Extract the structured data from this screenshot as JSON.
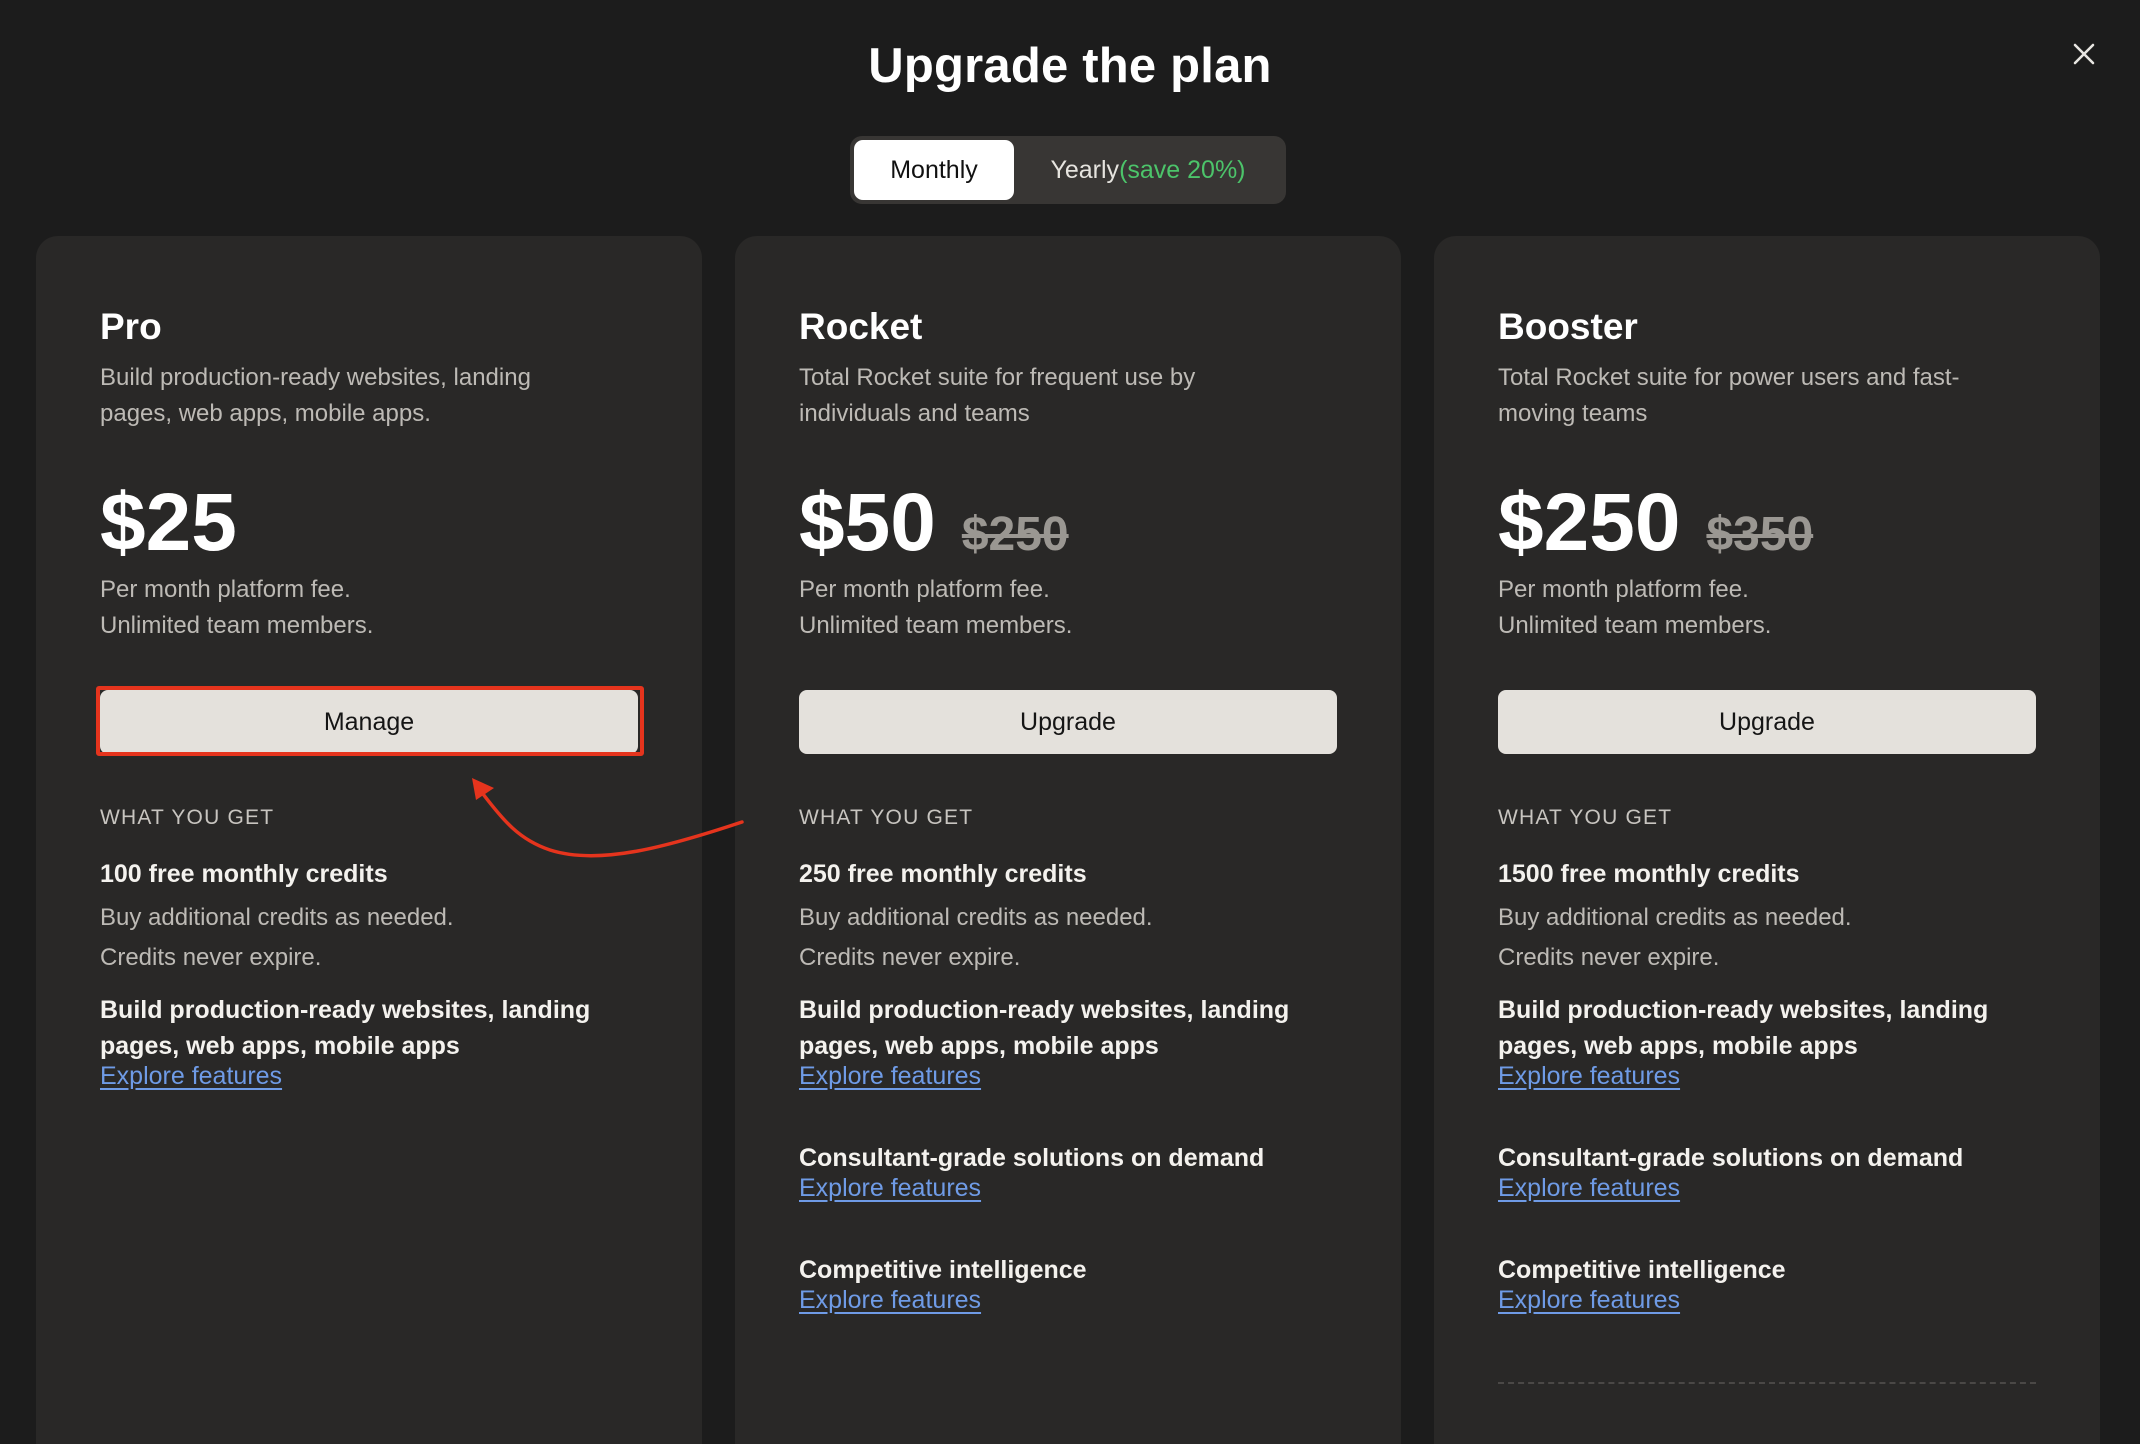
{
  "header": {
    "title": "Upgrade the plan",
    "close_icon": "close-icon"
  },
  "billing_toggle": {
    "monthly_label": "Monthly",
    "yearly_label": "Yearly",
    "yearly_savings": "(save 20%)",
    "selected": "Monthly"
  },
  "plans": [
    {
      "name": "Pro",
      "description": "Build production-ready websites, landing pages, web apps, mobile apps.",
      "price": "$25",
      "old_price": "",
      "fee_line1": "Per month platform fee.",
      "fee_line2": "Unlimited team members.",
      "button_label": "Manage",
      "section_label": "WHAT YOU GET",
      "credits_title": "100 free monthly credits",
      "credits_line1": "Buy additional credits as needed.",
      "credits_line2": "Credits never expire.",
      "features": [
        {
          "title": "Build production-ready websites, landing pages, web apps, mobile apps",
          "link": "Explore features"
        }
      ]
    },
    {
      "name": "Rocket",
      "description": "Total Rocket suite for frequent use by individuals and teams",
      "price": "$50",
      "old_price": "$250",
      "fee_line1": "Per month platform fee.",
      "fee_line2": "Unlimited team members.",
      "button_label": "Upgrade",
      "section_label": "WHAT YOU GET",
      "credits_title": "250 free monthly credits",
      "credits_line1": "Buy additional credits as needed.",
      "credits_line2": "Credits never expire.",
      "features": [
        {
          "title": "Build production-ready websites, landing pages, web apps, mobile apps",
          "link": "Explore features"
        },
        {
          "title": "Consultant-grade solutions on demand",
          "link": "Explore features"
        },
        {
          "title": "Competitive intelligence",
          "link": "Explore features"
        }
      ]
    },
    {
      "name": "Booster",
      "description": "Total Rocket suite for power users and fast-moving teams",
      "price": "$250",
      "old_price": "$350",
      "fee_line1": "Per month platform fee.",
      "fee_line2": "Unlimited team members.",
      "button_label": "Upgrade",
      "section_label": "WHAT YOU GET",
      "credits_title": "1500 free monthly credits",
      "credits_line1": "Buy additional credits as needed.",
      "credits_line2": "Credits never expire.",
      "features": [
        {
          "title": "Build production-ready websites, landing pages, web apps, mobile apps",
          "link": "Explore features"
        },
        {
          "title": "Consultant-grade solutions on demand",
          "link": "Explore features"
        },
        {
          "title": "Competitive intelligence",
          "link": "Explore features"
        }
      ]
    }
  ],
  "colors": {
    "background": "#1c1c1c",
    "card": "#292827",
    "button": "#e4e1dc",
    "link": "#6f9be6",
    "savings_green": "#4cc46a",
    "annotation_red": "#e5341d"
  }
}
